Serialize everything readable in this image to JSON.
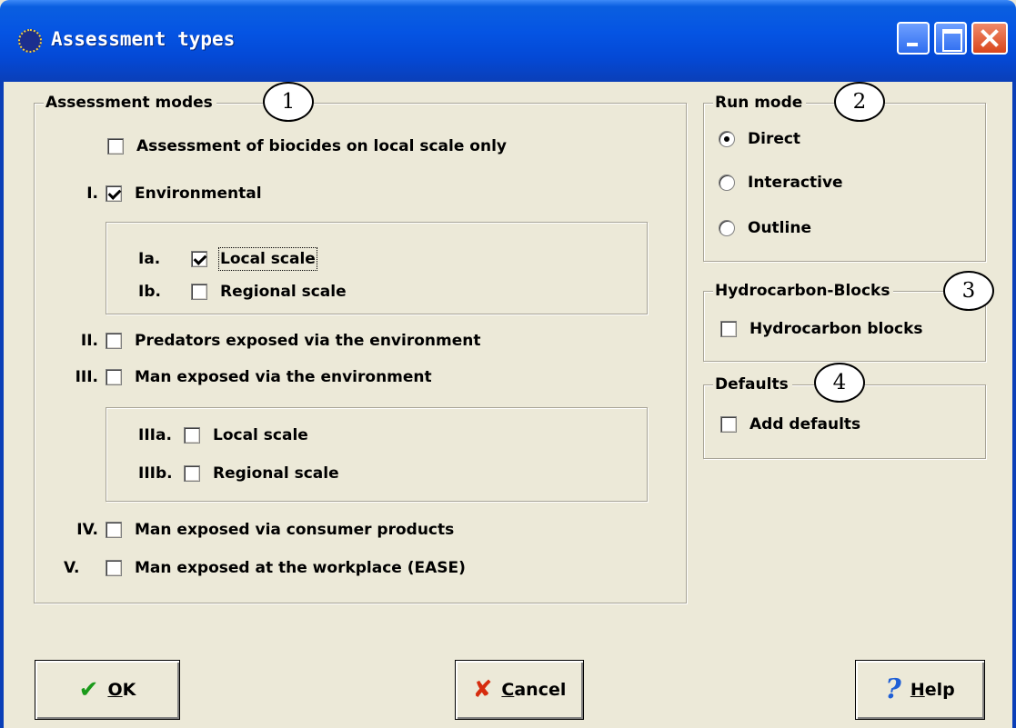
{
  "window": {
    "title": "Assessment types"
  },
  "assessment_modes": {
    "legend": "Assessment modes",
    "callout": "1",
    "biocides": {
      "label": "Assessment of biocides on local scale only",
      "checked": false
    },
    "items": [
      {
        "roman": "I.",
        "label": "Environmental",
        "checked": true
      },
      {
        "roman": "II.",
        "label": "Predators exposed via the environment",
        "checked": false
      },
      {
        "roman": "III.",
        "label": "Man exposed via the environment",
        "checked": false
      },
      {
        "roman": "IV.",
        "label": "Man exposed via consumer products",
        "checked": false
      },
      {
        "roman": "V.",
        "label": "Man exposed at the workplace (EASE)",
        "checked": false
      }
    ],
    "environmental_sub": [
      {
        "roman": "Ia.",
        "label": "Local scale",
        "checked": true
      },
      {
        "roman": "Ib.",
        "label": "Regional scale",
        "checked": false
      }
    ],
    "man_sub": [
      {
        "roman": "IIIa.",
        "label": "Local scale",
        "checked": false
      },
      {
        "roman": "IIIb.",
        "label": "Regional scale",
        "checked": false
      }
    ]
  },
  "run_mode": {
    "legend": "Run mode",
    "callout": "2",
    "options": [
      {
        "label": "Direct",
        "selected": true
      },
      {
        "label": "Interactive",
        "selected": false
      },
      {
        "label": "Outline",
        "selected": false
      }
    ]
  },
  "hydrocarbon": {
    "legend": "Hydrocarbon-Blocks",
    "callout": "3",
    "checkbox": {
      "label": "Hydrocarbon blocks",
      "checked": false
    }
  },
  "defaults": {
    "legend": "Defaults",
    "callout": "4",
    "checkbox": {
      "label": "Add defaults",
      "checked": false
    }
  },
  "buttons": {
    "ok": {
      "mnemonic": "O",
      "rest": "K"
    },
    "cancel": {
      "mnemonic": "C",
      "rest": "ancel"
    },
    "help": {
      "mnemonic": "H",
      "rest": "elp"
    }
  },
  "icons": {
    "ok": "check-icon",
    "cancel": "x-icon",
    "help": "question-icon"
  },
  "colors": {
    "title_bar": "#0554e3",
    "dialog_bg": "#ece9d8",
    "ok_icon": "#1a9a1a",
    "cancel_icon": "#d62c0e",
    "help_icon": "#1f5fd6"
  }
}
